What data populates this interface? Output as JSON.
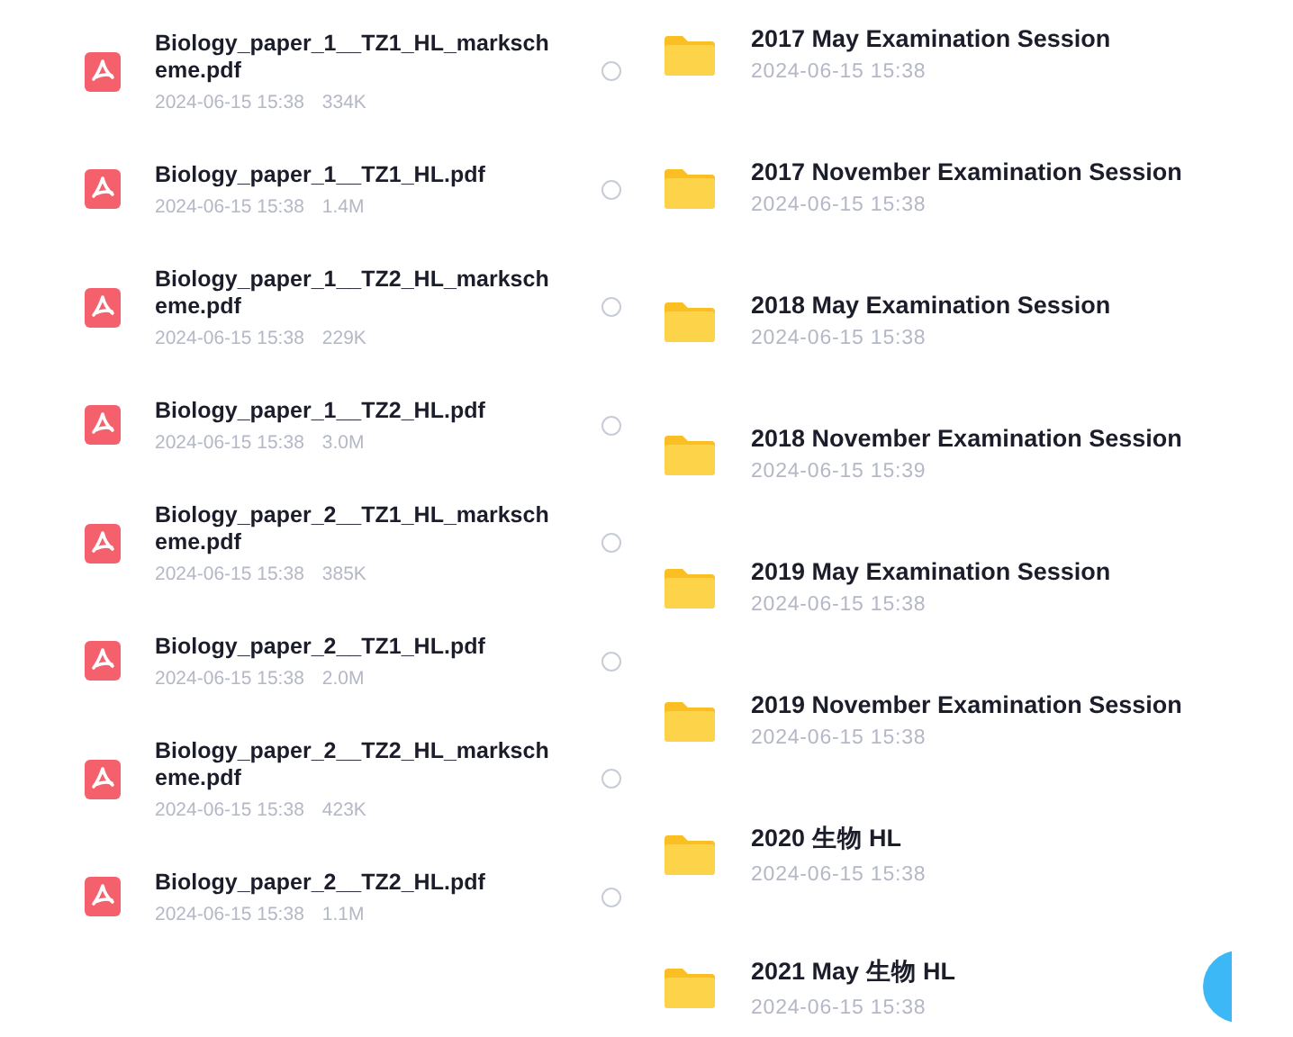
{
  "files": [
    {
      "name": "Biology_paper_1__TZ1_HL_markscheme.pdf",
      "date": "2024-06-15 15:38",
      "size": "334K",
      "selected": false
    },
    {
      "name": "Biology_paper_1__TZ1_HL.pdf",
      "date": "2024-06-15 15:38",
      "size": "1.4M",
      "selected": false
    },
    {
      "name": "Biology_paper_1__TZ2_HL_markscheme.pdf",
      "date": "2024-06-15 15:38",
      "size": "229K",
      "selected": false
    },
    {
      "name": "Biology_paper_1__TZ2_HL.pdf",
      "date": "2024-06-15 15:38",
      "size": "3.0M",
      "selected": false
    },
    {
      "name": "Biology_paper_2__TZ1_HL_markscheme.pdf",
      "date": "2024-06-15 15:38",
      "size": "385K",
      "selected": false
    },
    {
      "name": "Biology_paper_2__TZ1_HL.pdf",
      "date": "2024-06-15 15:38",
      "size": "2.0M",
      "selected": false
    },
    {
      "name": "Biology_paper_2__TZ2_HL_markscheme.pdf",
      "date": "2024-06-15 15:38",
      "size": "423K",
      "selected": false
    },
    {
      "name": "Biology_paper_2__TZ2_HL.pdf",
      "date": "2024-06-15 15:38",
      "size": "1.1M",
      "selected": false
    }
  ],
  "folders": [
    {
      "name": "2017 May Examination Session",
      "date": "2024-06-15 15:38"
    },
    {
      "name": "2017 November Examination Session",
      "date": "2024-06-15 15:38"
    },
    {
      "name": "2018 May Examination Session",
      "date": "2024-06-15 15:38"
    },
    {
      "name": "2018 November Examination Session",
      "date": "2024-06-15 15:39"
    },
    {
      "name": "2019 May Examination Session",
      "date": "2024-06-15 15:38"
    },
    {
      "name": "2019 November Examination Session",
      "date": "2024-06-15 15:38"
    },
    {
      "name": "2020 生物 HL",
      "date": "2024-06-15 15:38"
    },
    {
      "name": "2021 May 生物 HL",
      "date": "2024-06-15 15:38"
    }
  ]
}
